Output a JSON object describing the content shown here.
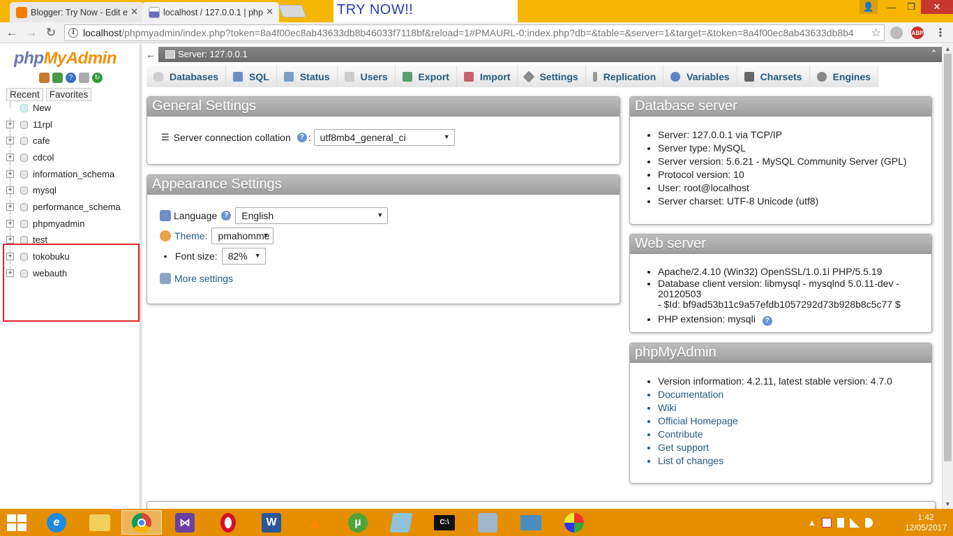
{
  "browser": {
    "tabs": [
      {
        "title": "Blogger: Try Now - Edit e",
        "favicon": "blogger-icon"
      },
      {
        "title": "localhost / 127.0.0.1 | php",
        "favicon": "phpmyadmin-icon"
      }
    ],
    "banner_text": "TRY NOW!!",
    "url_host": "localhost",
    "url_path": "/phpmyadmin/index.php?token=8a4f00ec8ab43633db8b46033f7118bf&reload=1#PMAURL-0:index.php?db=&table=&server=1&target=&token=8a4f00ec8ab43633db8b4",
    "extensions": [
      "extension-icon",
      "ABP"
    ]
  },
  "sidebar": {
    "logo": {
      "php": "php",
      "my": "My",
      "admin": "Admin"
    },
    "recent_label": "Recent",
    "favorites_label": "Favorites",
    "new_label": "New",
    "databases": [
      "11rpl",
      "cafe",
      "cdcol",
      "information_schema",
      "mysql",
      "performance_schema",
      "phpmyadmin",
      "test",
      "tokobuku",
      "webauth"
    ]
  },
  "serverbar": {
    "label": "Server: 127.0.0.1"
  },
  "nav_tabs": [
    {
      "label": "Databases",
      "icon": "i-db"
    },
    {
      "label": "SQL",
      "icon": "i-sql"
    },
    {
      "label": "Status",
      "icon": "i-status"
    },
    {
      "label": "Users",
      "icon": "i-users"
    },
    {
      "label": "Export",
      "icon": "i-export"
    },
    {
      "label": "Import",
      "icon": "i-import"
    },
    {
      "label": "Settings",
      "icon": "i-settings"
    },
    {
      "label": "Replication",
      "icon": "i-repl"
    },
    {
      "label": "Variables",
      "icon": "i-vars"
    },
    {
      "label": "Charsets",
      "icon": "i-charsets"
    },
    {
      "label": "Engines",
      "icon": "i-engines"
    }
  ],
  "general": {
    "title": "General Settings",
    "collation_label": "Server connection collation",
    "collation_value": "utf8mb4_general_ci"
  },
  "appearance": {
    "title": "Appearance Settings",
    "language_label": "Language",
    "language_value": "English",
    "theme_label": "Theme:",
    "theme_value": "pmahomme",
    "fontsize_label": "Font size:",
    "fontsize_value": "82%",
    "more_settings": "More settings"
  },
  "db_server": {
    "title": "Database server",
    "items": [
      "Server: 127.0.0.1 via TCP/IP",
      "Server type: MySQL",
      "Server version: 5.6.21 - MySQL Community Server (GPL)",
      "Protocol version: 10",
      "User: root@localhost",
      "Server charset: UTF-8 Unicode (utf8)"
    ]
  },
  "web_server": {
    "title": "Web server",
    "apache": "Apache/2.4.10 (Win32) OpenSSL/1.0.1i PHP/5.5.19",
    "client_version_line1": "Database client version: libmysql - mysqlnd 5.0.11-dev - 20120503",
    "client_version_line2": "- $Id: bf9ad53b11c9a57efdb1057292d73b928b8c5c77 $",
    "php_extension": "PHP extension: mysqli"
  },
  "pma_info": {
    "title": "phpMyAdmin",
    "version": "Version information: 4.2.11, latest stable version: 4.7.0",
    "links": [
      "Documentation",
      "Wiki",
      "Official Homepage",
      "Contribute",
      "Get support",
      "List of changes"
    ]
  },
  "taskbar": {
    "apps": [
      "ie-icon",
      "file-explorer-icon",
      "chrome-icon",
      "visual-studio-icon",
      "opera-icon",
      "word-icon",
      "vlc-icon",
      "utorrent-icon",
      "notebook-icon",
      "cmd-icon",
      "perfmon-icon",
      "photos-icon",
      "paint-icon"
    ],
    "time": "1:42",
    "date": "12/05/2017"
  },
  "colors": {
    "browser_frame": "#f6b500",
    "taskbar": "#e48e00",
    "link": "#235a81",
    "highlight_box": "#e0242a",
    "panel_header": "#a8a8a8"
  }
}
